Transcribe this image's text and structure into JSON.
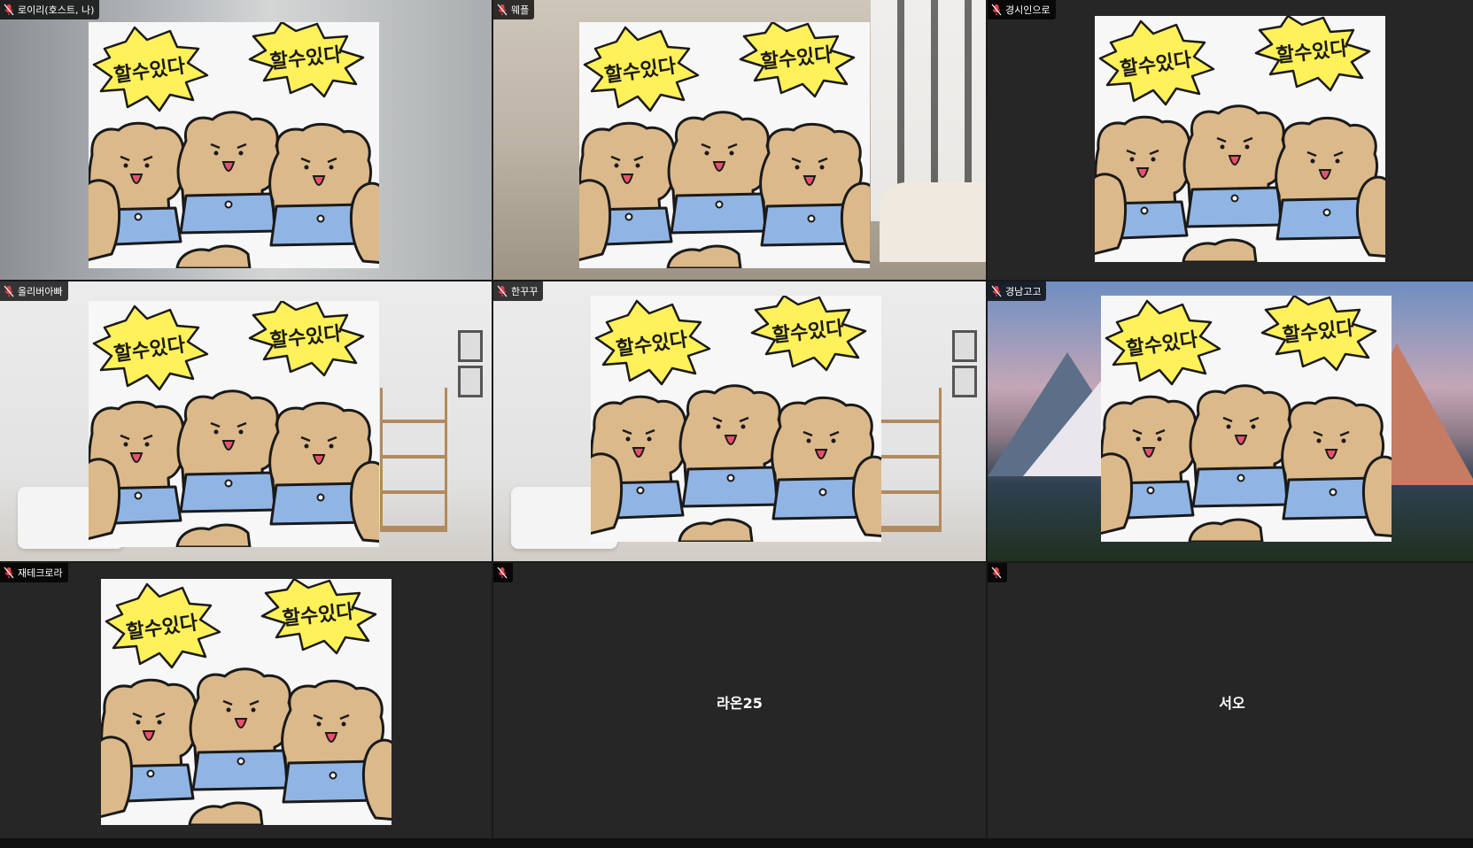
{
  "sticker": {
    "left_text": "할수있다",
    "right_text": "할수있다",
    "colors": {
      "burst": "#fff159",
      "bear": "#dcb98a",
      "bear_dark": "#c9a576",
      "shirt": "#90b5e5",
      "outline": "#1a1a1a",
      "tongue": "#e8506b"
    }
  },
  "tiles": [
    {
      "id": "tile-1",
      "name": "로이리(호스트, 나)",
      "has_video": true,
      "background": "wall"
    },
    {
      "id": "tile-2",
      "name": "웨플",
      "has_video": true,
      "background": "lobby"
    },
    {
      "id": "tile-3",
      "name": "경시인으로",
      "has_video": true,
      "background": "dark"
    },
    {
      "id": "tile-4",
      "name": "올리버아빠",
      "has_video": true,
      "background": "room"
    },
    {
      "id": "tile-5",
      "name": "한꾸꾸",
      "has_video": true,
      "background": "room"
    },
    {
      "id": "tile-6",
      "name": "경남고고",
      "has_video": true,
      "background": "mountain"
    },
    {
      "id": "tile-7",
      "name": "재테크로라",
      "has_video": true,
      "background": "dark"
    },
    {
      "id": "tile-8",
      "name": "",
      "center_name": "라온25",
      "has_video": false,
      "background": "dark"
    },
    {
      "id": "tile-9",
      "name": "",
      "center_name": "서오",
      "has_video": false,
      "background": "dark"
    }
  ],
  "icons": {
    "muted_mic": "mic-muted-icon"
  },
  "colors": {
    "tile_bg": "#262626",
    "muted_mic": "#e8424a"
  }
}
